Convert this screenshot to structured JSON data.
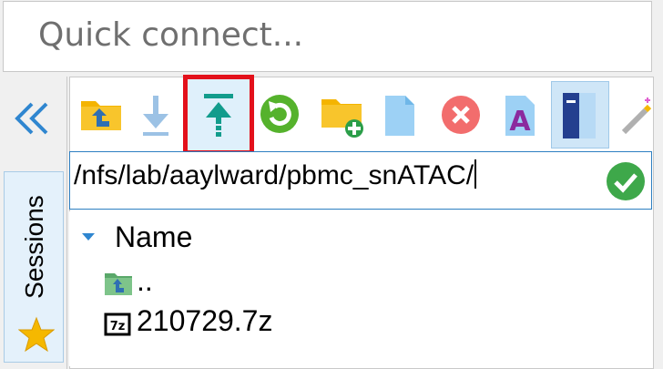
{
  "quick_connect": {
    "placeholder": "Quick connect..."
  },
  "sidebar": {
    "collapse_icon": "double-chevron-left-icon",
    "sessions_tab": {
      "label": "Sessions",
      "icon": "star-icon"
    }
  },
  "toolbar": {
    "buttons": [
      {
        "name": "parent-folder-button",
        "icon": "folder-up-icon"
      },
      {
        "name": "download-button",
        "icon": "download-arrow-icon"
      },
      {
        "name": "upload-button",
        "icon": "upload-arrow-icon",
        "highlighted": true
      },
      {
        "name": "refresh-button",
        "icon": "refresh-icon"
      },
      {
        "name": "new-folder-button",
        "icon": "folder-plus-icon"
      },
      {
        "name": "new-file-button",
        "icon": "file-icon"
      },
      {
        "name": "delete-button",
        "icon": "delete-x-icon"
      },
      {
        "name": "rename-button",
        "icon": "letter-a-icon"
      },
      {
        "name": "toggle-view-button",
        "icon": "panel-icon",
        "pressed": true
      },
      {
        "name": "magic-wand-button",
        "icon": "magic-wand-icon"
      }
    ],
    "highlight_color": "#e3111b"
  },
  "path_bar": {
    "value": "/nfs/lab/aaylward/pbmc_snATAC/",
    "confirm_icon": "checkmark-circle-icon"
  },
  "file_list": {
    "column_header": "Name",
    "rows": [
      {
        "name": "..",
        "icon": "folder-up-icon"
      },
      {
        "name": "210729.7z",
        "icon": "7z-archive-icon"
      }
    ]
  }
}
